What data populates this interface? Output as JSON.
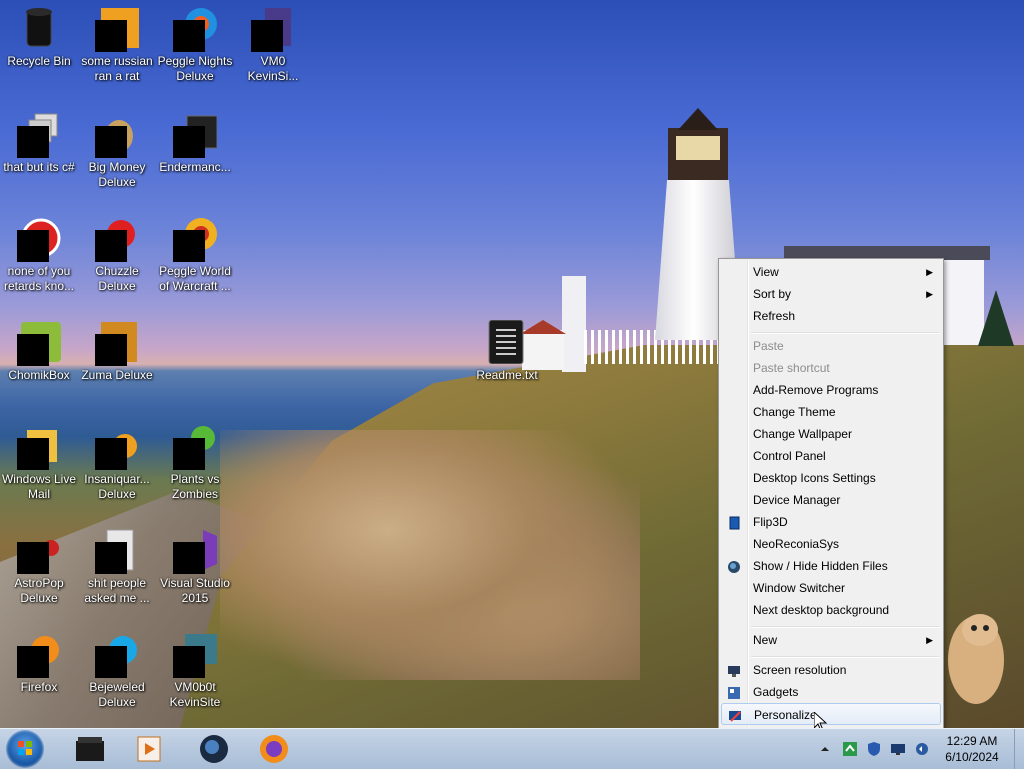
{
  "desktop": {
    "icons": [
      {
        "label": "Recycle Bin",
        "icon": "recycle-bin-icon"
      },
      {
        "label": "some russian ran a rat",
        "icon": "app-icon"
      },
      {
        "label": "Peggle Nights Deluxe",
        "icon": "peggle-icon"
      },
      {
        "label": "VM0 KevinSi...",
        "icon": "app-icon"
      },
      {
        "label": "that but its c#",
        "icon": "window-icon"
      },
      {
        "label": "Big Money Deluxe",
        "icon": "money-bag-icon"
      },
      {
        "label": "Endermanc...",
        "icon": "terminal-icon"
      },
      {
        "label": "none of you retards kno...",
        "icon": "app-icon"
      },
      {
        "label": "Chuzzle Deluxe",
        "icon": "chuzzle-icon"
      },
      {
        "label": "Peggle World of Warcraft ...",
        "icon": "peggle-icon"
      },
      {
        "label": "ChomikBox",
        "icon": "chomikbox-icon"
      },
      {
        "label": "Zuma Deluxe",
        "icon": "zuma-icon"
      },
      {
        "label": "Readme.txt",
        "icon": "text-file-icon"
      },
      {
        "label": "Windows Live Mail",
        "icon": "mail-icon"
      },
      {
        "label": "Insaniquar... Deluxe",
        "icon": "fish-icon"
      },
      {
        "label": "Plants vs Zombies",
        "icon": "plant-icon"
      },
      {
        "label": "AstroPop Deluxe",
        "icon": "astropop-icon"
      },
      {
        "label": "shit people asked me ...",
        "icon": "folder-icon"
      },
      {
        "label": "Visual Studio 2015",
        "icon": "visual-studio-icon"
      },
      {
        "label": "Firefox",
        "icon": "firefox-icon"
      },
      {
        "label": "Bejeweled Deluxe",
        "icon": "gem-icon"
      },
      {
        "label": "VM0b0t KevinSite",
        "icon": "app-icon"
      }
    ]
  },
  "context_menu": {
    "items": [
      {
        "label": "View",
        "submenu": true
      },
      {
        "label": "Sort by",
        "submenu": true
      },
      {
        "label": "Refresh"
      },
      {
        "label": "Paste",
        "disabled": true
      },
      {
        "label": "Paste shortcut",
        "disabled": true
      },
      {
        "label": "Add-Remove Programs"
      },
      {
        "label": "Change Theme"
      },
      {
        "label": "Change Wallpaper"
      },
      {
        "label": "Control Panel"
      },
      {
        "label": "Desktop Icons Settings"
      },
      {
        "label": "Device Manager"
      },
      {
        "label": "Flip3D",
        "icon": "flip3d-icon"
      },
      {
        "label": "NeoReconiaSys"
      },
      {
        "label": "Show / Hide Hidden Files",
        "icon": "globe-icon"
      },
      {
        "label": "Window Switcher"
      },
      {
        "label": "Next desktop background"
      },
      {
        "label": "New",
        "submenu": true
      },
      {
        "label": "Screen resolution",
        "icon": "monitor-icon"
      },
      {
        "label": "Gadgets",
        "icon": "gadgets-icon"
      },
      {
        "label": "Personalize",
        "icon": "personalize-icon",
        "highlighted": true
      }
    ]
  },
  "taskbar": {
    "start_button": "start-orb-icon",
    "pinned": [
      "explorer-icon",
      "media-player-icon",
      "globe-icon",
      "firefox-icon"
    ],
    "tray": [
      "chevron-up-icon",
      "sync-icon",
      "shield-icon",
      "monitor-icon",
      "volume-icon"
    ],
    "clock": {
      "time": "12:29 AM",
      "date": "6/10/2024"
    }
  }
}
